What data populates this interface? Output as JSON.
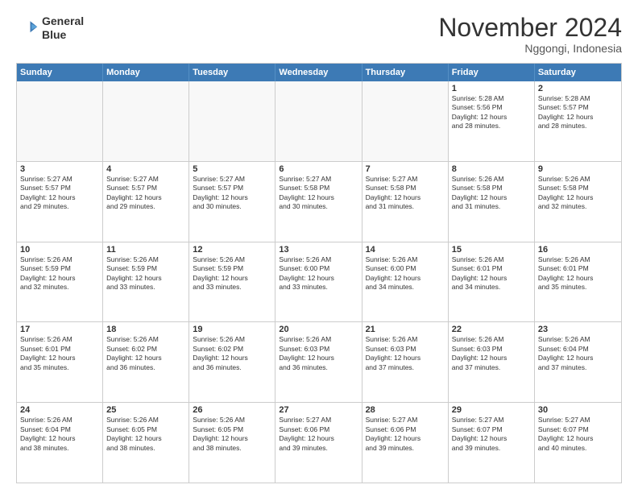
{
  "header": {
    "logo_line1": "General",
    "logo_line2": "Blue",
    "month": "November 2024",
    "location": "Nggongi, Indonesia"
  },
  "weekdays": [
    "Sunday",
    "Monday",
    "Tuesday",
    "Wednesday",
    "Thursday",
    "Friday",
    "Saturday"
  ],
  "rows": [
    [
      {
        "day": "",
        "info": "",
        "empty": true
      },
      {
        "day": "",
        "info": "",
        "empty": true
      },
      {
        "day": "",
        "info": "",
        "empty": true
      },
      {
        "day": "",
        "info": "",
        "empty": true
      },
      {
        "day": "",
        "info": "",
        "empty": true
      },
      {
        "day": "1",
        "info": "Sunrise: 5:28 AM\nSunset: 5:56 PM\nDaylight: 12 hours\nand 28 minutes.",
        "empty": false
      },
      {
        "day": "2",
        "info": "Sunrise: 5:28 AM\nSunset: 5:57 PM\nDaylight: 12 hours\nand 28 minutes.",
        "empty": false
      }
    ],
    [
      {
        "day": "3",
        "info": "Sunrise: 5:27 AM\nSunset: 5:57 PM\nDaylight: 12 hours\nand 29 minutes.",
        "empty": false
      },
      {
        "day": "4",
        "info": "Sunrise: 5:27 AM\nSunset: 5:57 PM\nDaylight: 12 hours\nand 29 minutes.",
        "empty": false
      },
      {
        "day": "5",
        "info": "Sunrise: 5:27 AM\nSunset: 5:57 PM\nDaylight: 12 hours\nand 30 minutes.",
        "empty": false
      },
      {
        "day": "6",
        "info": "Sunrise: 5:27 AM\nSunset: 5:58 PM\nDaylight: 12 hours\nand 30 minutes.",
        "empty": false
      },
      {
        "day": "7",
        "info": "Sunrise: 5:27 AM\nSunset: 5:58 PM\nDaylight: 12 hours\nand 31 minutes.",
        "empty": false
      },
      {
        "day": "8",
        "info": "Sunrise: 5:26 AM\nSunset: 5:58 PM\nDaylight: 12 hours\nand 31 minutes.",
        "empty": false
      },
      {
        "day": "9",
        "info": "Sunrise: 5:26 AM\nSunset: 5:58 PM\nDaylight: 12 hours\nand 32 minutes.",
        "empty": false
      }
    ],
    [
      {
        "day": "10",
        "info": "Sunrise: 5:26 AM\nSunset: 5:59 PM\nDaylight: 12 hours\nand 32 minutes.",
        "empty": false
      },
      {
        "day": "11",
        "info": "Sunrise: 5:26 AM\nSunset: 5:59 PM\nDaylight: 12 hours\nand 33 minutes.",
        "empty": false
      },
      {
        "day": "12",
        "info": "Sunrise: 5:26 AM\nSunset: 5:59 PM\nDaylight: 12 hours\nand 33 minutes.",
        "empty": false
      },
      {
        "day": "13",
        "info": "Sunrise: 5:26 AM\nSunset: 6:00 PM\nDaylight: 12 hours\nand 33 minutes.",
        "empty": false
      },
      {
        "day": "14",
        "info": "Sunrise: 5:26 AM\nSunset: 6:00 PM\nDaylight: 12 hours\nand 34 minutes.",
        "empty": false
      },
      {
        "day": "15",
        "info": "Sunrise: 5:26 AM\nSunset: 6:01 PM\nDaylight: 12 hours\nand 34 minutes.",
        "empty": false
      },
      {
        "day": "16",
        "info": "Sunrise: 5:26 AM\nSunset: 6:01 PM\nDaylight: 12 hours\nand 35 minutes.",
        "empty": false
      }
    ],
    [
      {
        "day": "17",
        "info": "Sunrise: 5:26 AM\nSunset: 6:01 PM\nDaylight: 12 hours\nand 35 minutes.",
        "empty": false
      },
      {
        "day": "18",
        "info": "Sunrise: 5:26 AM\nSunset: 6:02 PM\nDaylight: 12 hours\nand 36 minutes.",
        "empty": false
      },
      {
        "day": "19",
        "info": "Sunrise: 5:26 AM\nSunset: 6:02 PM\nDaylight: 12 hours\nand 36 minutes.",
        "empty": false
      },
      {
        "day": "20",
        "info": "Sunrise: 5:26 AM\nSunset: 6:03 PM\nDaylight: 12 hours\nand 36 minutes.",
        "empty": false
      },
      {
        "day": "21",
        "info": "Sunrise: 5:26 AM\nSunset: 6:03 PM\nDaylight: 12 hours\nand 37 minutes.",
        "empty": false
      },
      {
        "day": "22",
        "info": "Sunrise: 5:26 AM\nSunset: 6:03 PM\nDaylight: 12 hours\nand 37 minutes.",
        "empty": false
      },
      {
        "day": "23",
        "info": "Sunrise: 5:26 AM\nSunset: 6:04 PM\nDaylight: 12 hours\nand 37 minutes.",
        "empty": false
      }
    ],
    [
      {
        "day": "24",
        "info": "Sunrise: 5:26 AM\nSunset: 6:04 PM\nDaylight: 12 hours\nand 38 minutes.",
        "empty": false
      },
      {
        "day": "25",
        "info": "Sunrise: 5:26 AM\nSunset: 6:05 PM\nDaylight: 12 hours\nand 38 minutes.",
        "empty": false
      },
      {
        "day": "26",
        "info": "Sunrise: 5:26 AM\nSunset: 6:05 PM\nDaylight: 12 hours\nand 38 minutes.",
        "empty": false
      },
      {
        "day": "27",
        "info": "Sunrise: 5:27 AM\nSunset: 6:06 PM\nDaylight: 12 hours\nand 39 minutes.",
        "empty": false
      },
      {
        "day": "28",
        "info": "Sunrise: 5:27 AM\nSunset: 6:06 PM\nDaylight: 12 hours\nand 39 minutes.",
        "empty": false
      },
      {
        "day": "29",
        "info": "Sunrise: 5:27 AM\nSunset: 6:07 PM\nDaylight: 12 hours\nand 39 minutes.",
        "empty": false
      },
      {
        "day": "30",
        "info": "Sunrise: 5:27 AM\nSunset: 6:07 PM\nDaylight: 12 hours\nand 40 minutes.",
        "empty": false
      }
    ]
  ]
}
